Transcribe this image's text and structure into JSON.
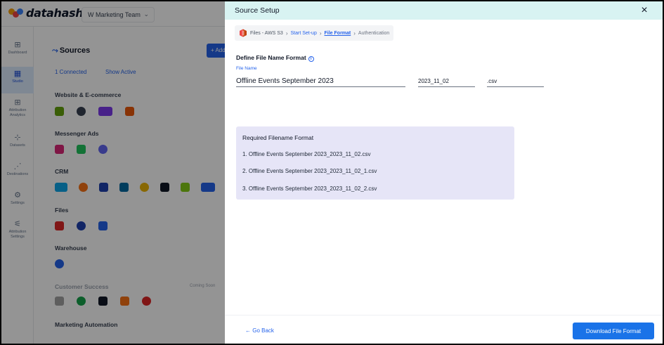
{
  "app": {
    "logo_text": "datahash",
    "team_selector": "W Marketing Team",
    "sidebar": [
      {
        "label": "Dashboard",
        "icon": "grid-icon"
      },
      {
        "label": "Studio",
        "icon": "studio-icon"
      },
      {
        "label": "Attribution Analytics",
        "icon": "analytics-icon"
      },
      {
        "label": "Datasets",
        "icon": "datasets-icon"
      },
      {
        "label": "Destinations",
        "icon": "destinations-icon"
      },
      {
        "label": "Settings",
        "icon": "settings-icon"
      },
      {
        "label": "Attribution Settings",
        "icon": "attribution-settings-icon"
      }
    ],
    "sources_title": "Sources",
    "add_label": "+ Add",
    "filter_connected": "1 Connected",
    "filter_available": "Show Active",
    "sections": [
      "Website & E-commerce",
      "Messenger Ads",
      "CRM",
      "Files",
      "Warehouse",
      "Customer Success",
      "Marketing Automation"
    ],
    "coming_soon": "Coming Soon"
  },
  "drawer": {
    "title": "Source Setup",
    "close_label": "×",
    "breadcrumb": {
      "source": "Files - AWS S3",
      "step1": "Start Set-up",
      "step2": "File Format",
      "step3": "Authentication",
      "separator": "›"
    },
    "define_label": "Define File Name Format",
    "info_symbol": "i",
    "file_name_label": "File Name",
    "fields": {
      "name": "Offline Events September 2023",
      "date": "2023_11_02",
      "extension": ".csv"
    },
    "format_box": {
      "title": "Required Filename Format",
      "examples": [
        "1. Offline Events September 2023_2023_11_02.csv",
        "2. Offline Events September 2023_2023_11_02_1.csv",
        "3. Offline Events September 2023_2023_11_02_2.csv"
      ]
    },
    "footer": {
      "back_label": "← Go Back",
      "download_label": "Download File Format"
    }
  },
  "colors": {
    "accent": "#1a73e8",
    "header_bg": "#d8f3f2",
    "format_box_bg": "#e6e5f7"
  }
}
